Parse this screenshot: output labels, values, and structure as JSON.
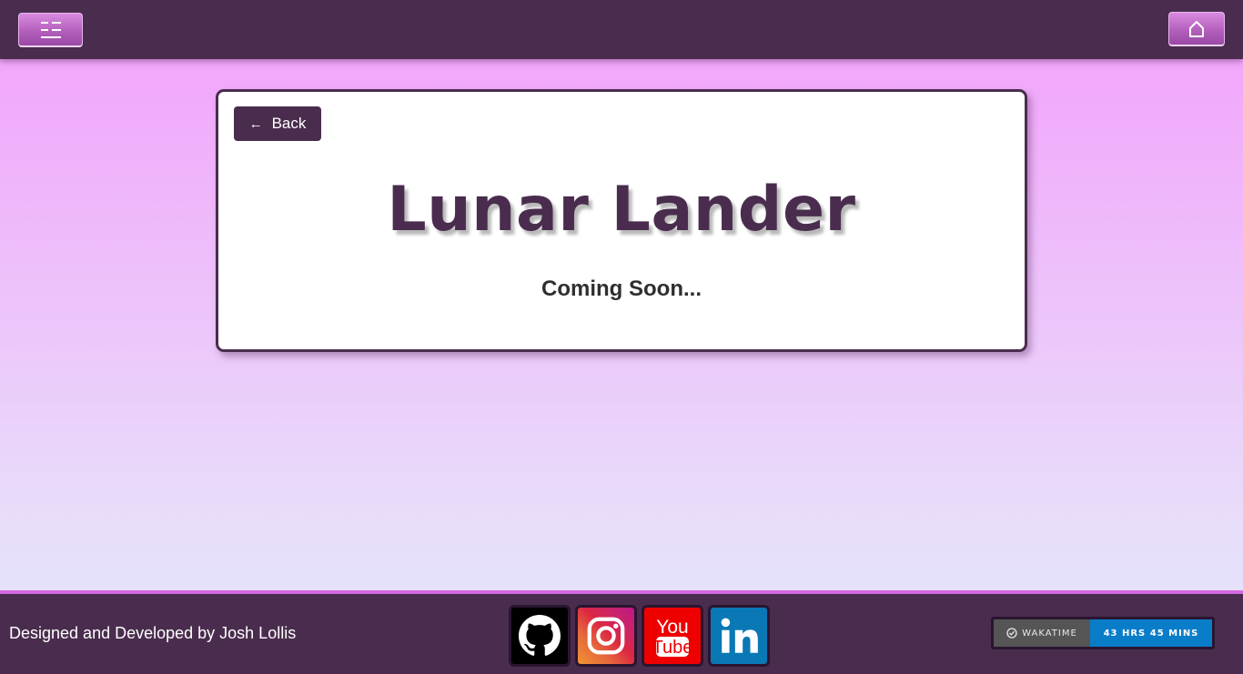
{
  "header": {
    "menu_icon": "menu-lines-icon",
    "home_icon": "home-icon"
  },
  "card": {
    "back_arrow": "←",
    "back_label": "Back",
    "title": "Lunar Lander",
    "subtitle": "Coming Soon..."
  },
  "footer": {
    "credit": "Designed and Developed by Josh Lollis",
    "socials": [
      {
        "name": "github",
        "icon": "github-icon",
        "color": "#000000"
      },
      {
        "name": "instagram",
        "icon": "instagram-icon",
        "color": "#dc2743"
      },
      {
        "name": "youtube",
        "icon": "youtube-icon",
        "color": "#ee0000"
      },
      {
        "name": "linkedin",
        "icon": "linkedin-icon",
        "color": "#0a78b5"
      }
    ],
    "wakatime": {
      "label": "WAKATIME",
      "value": "43 HRS 45 MINS"
    }
  },
  "colors": {
    "primary": "#4a2d4e",
    "accent": "#d46be0"
  }
}
